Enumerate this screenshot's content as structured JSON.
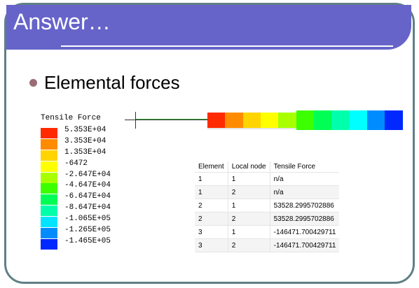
{
  "slide": {
    "title": "Answer…"
  },
  "bullet": {
    "text": "Elemental forces"
  },
  "legend": {
    "title": "Tensile Force",
    "items": [
      {
        "label": "5.353E+04",
        "color": "#ff2a00"
      },
      {
        "label": "3.353E+04",
        "color": "#ff8c00"
      },
      {
        "label": "1.353E+04",
        "color": "#ffd400"
      },
      {
        "label": "-6472",
        "color": "#ffff00"
      },
      {
        "label": "-2.647E+04",
        "color": "#a8ff00"
      },
      {
        "label": "-4.647E+04",
        "color": "#3cff00"
      },
      {
        "label": "-6.647E+04",
        "color": "#00ff55"
      },
      {
        "label": "-8.647E+04",
        "color": "#00ffaa"
      },
      {
        "label": "-1.065E+05",
        "color": "#00e4ff"
      },
      {
        "label": "-1.265E+05",
        "color": "#008cff"
      },
      {
        "label": "-1.465E+05",
        "color": "#0028ff"
      }
    ]
  },
  "bar": {
    "segments": [
      {
        "color": "#ff2a00"
      },
      {
        "color": "#ff8c00"
      },
      {
        "color": "#ffd400"
      },
      {
        "color": "#ffff00"
      },
      {
        "color": "#a8ff00"
      },
      {
        "color": "#3cff00"
      },
      {
        "color": "#00ff55"
      },
      {
        "color": "#00ffaa"
      },
      {
        "color": "#00ffff"
      },
      {
        "color": "#008cff"
      },
      {
        "color": "#0028ff"
      }
    ]
  },
  "table": {
    "headers": [
      "Element",
      "Local node",
      "Tensile Force"
    ],
    "rows": [
      [
        "1",
        "1",
        "n/a"
      ],
      [
        "1",
        "2",
        "n/a"
      ],
      [
        "2",
        "1",
        "53528.2995702886"
      ],
      [
        "2",
        "2",
        "53528.2995702886"
      ],
      [
        "3",
        "1",
        "-146471.700429711"
      ],
      [
        "3",
        "2",
        "-146471.700429711"
      ]
    ]
  }
}
